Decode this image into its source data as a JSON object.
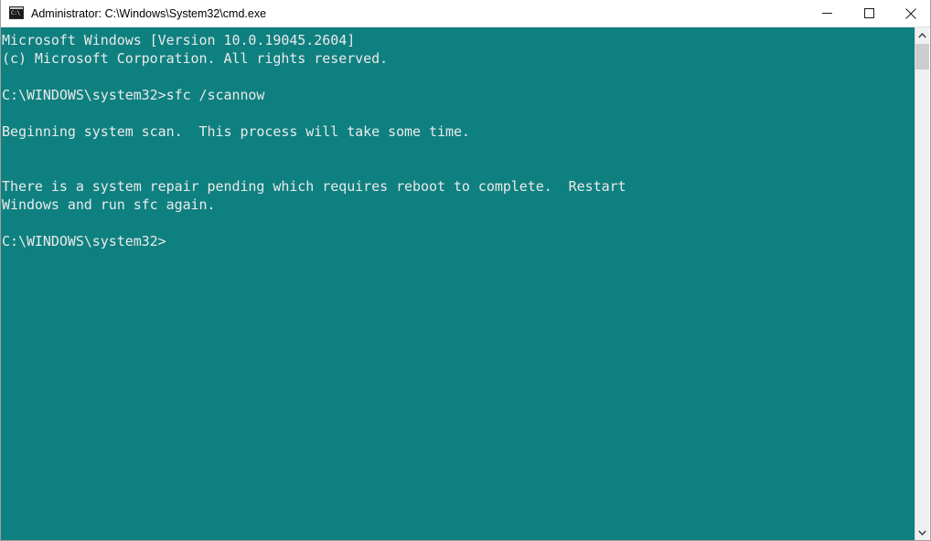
{
  "window": {
    "title": "Administrator: C:\\Windows\\System32\\cmd.exe",
    "icon": "cmd-console-icon",
    "icon_glyph": "C:\\",
    "colors": {
      "titlebar_bg": "#ffffff",
      "titlebar_text": "#000000",
      "console_bg": "#0f8080",
      "console_text": "#eaeaea",
      "scrollbar_track": "#f0f0f0",
      "scrollbar_thumb": "#cdcdcd",
      "window_border": "#9e9e9e"
    },
    "controls": {
      "minimize_label": "Minimize",
      "maximize_label": "Maximize",
      "close_label": "Close"
    }
  },
  "console": {
    "lines": [
      "Microsoft Windows [Version 10.0.19045.2604]",
      "(c) Microsoft Corporation. All rights reserved.",
      "",
      "C:\\WINDOWS\\system32>sfc /scannow",
      "",
      "Beginning system scan.  This process will take some time.",
      "",
      "",
      "There is a system repair pending which requires reboot to complete.  Restart",
      "Windows and run sfc again.",
      "",
      "C:\\WINDOWS\\system32>"
    ],
    "text": "Microsoft Windows [Version 10.0.19045.2604]\n(c) Microsoft Corporation. All rights reserved.\n\nC:\\WINDOWS\\system32>sfc /scannow\n\nBeginning system scan.  This process will take some time.\n\n\nThere is a system repair pending which requires reboot to complete.  Restart\nWindows and run sfc again.\n\nC:\\WINDOWS\\system32>",
    "command": "sfc /scannow",
    "prompt": "C:\\WINDOWS\\system32>",
    "os_version": "10.0.19045.2604"
  },
  "scrollbar": {
    "up_arrow": "chevron-up-icon",
    "down_arrow": "chevron-down-icon",
    "thumb_position_percent": 3
  }
}
